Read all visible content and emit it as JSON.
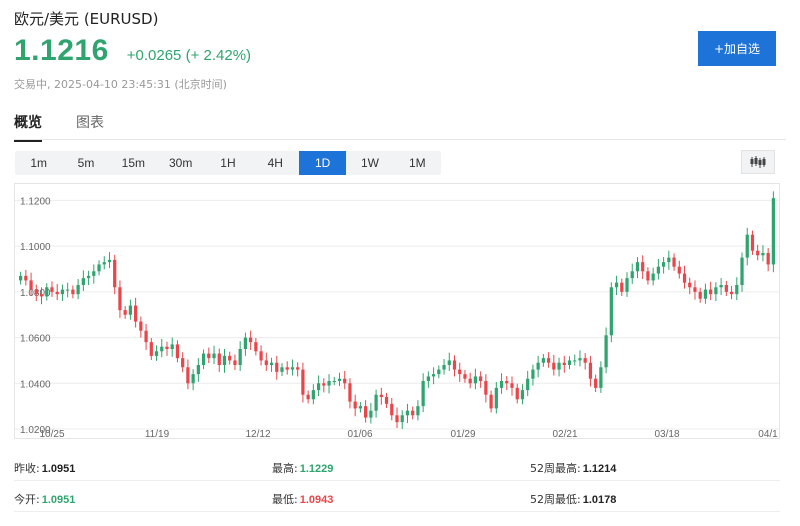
{
  "header": {
    "title": "欧元/美元  (EURUSD)",
    "price": "1.1216",
    "change": "+0.0265 (+ 2.42%)",
    "status": "交易中, 2025-04-10 23:45:31 (北京时间)",
    "add_button": "+加自选"
  },
  "tabs": [
    {
      "label": "概览",
      "active": true
    },
    {
      "label": "图表",
      "active": false
    }
  ],
  "periods": [
    "1m",
    "5m",
    "15m",
    "30m",
    "1H",
    "4H",
    "1D",
    "1W",
    "1M"
  ],
  "active_period": "1D",
  "colors": {
    "up": "#2fa46f",
    "down": "#e8464a",
    "accent": "#1e73d8"
  },
  "stats": {
    "prev_close": {
      "label": "昨收:",
      "value": "1.0951"
    },
    "open": {
      "label": "今开:",
      "value": "1.0951"
    },
    "high": {
      "label": "最高:",
      "value": "1.1229"
    },
    "low": {
      "label": "最低:",
      "value": "1.0943"
    },
    "week52_high": {
      "label": "52周最高:",
      "value": "1.1214"
    },
    "week52_low": {
      "label": "52周最低:",
      "value": "1.0178"
    }
  },
  "chart_data": {
    "type": "candlestick",
    "y_ticks": [
      "1.1200",
      "1.1000",
      "1.0800",
      "1.0600",
      "1.0400",
      "1.0200"
    ],
    "y_tick_values": [
      1.12,
      1.1,
      1.08,
      1.06,
      1.04,
      1.02
    ],
    "ylim": [
      1.02,
      1.125
    ],
    "x_ticks": [
      "10/25",
      "11/19",
      "12/12",
      "01/06",
      "01/29",
      "02/21",
      "03/18",
      "04/1"
    ],
    "grid": true,
    "closes": [
      1.087,
      1.085,
      1.081,
      1.079,
      1.078,
      1.082,
      1.08,
      1.079,
      1.081,
      1.081,
      1.079,
      1.083,
      1.086,
      1.087,
      1.089,
      1.092,
      1.093,
      1.094,
      1.082,
      1.072,
      1.07,
      1.074,
      1.067,
      1.063,
      1.058,
      1.052,
      1.054,
      1.056,
      1.055,
      1.057,
      1.051,
      1.047,
      1.04,
      1.044,
      1.048,
      1.053,
      1.051,
      1.053,
      1.048,
      1.052,
      1.05,
      1.048,
      1.055,
      1.06,
      1.058,
      1.054,
      1.05,
      1.048,
      1.049,
      1.045,
      1.047,
      1.046,
      1.047,
      1.046,
      1.035,
      1.033,
      1.037,
      1.04,
      1.039,
      1.041,
      1.041,
      1.042,
      1.04,
      1.032,
      1.029,
      1.03,
      1.025,
      1.028,
      1.035,
      1.034,
      1.031,
      1.026,
      1.023,
      1.026,
      1.028,
      1.026,
      1.03,
      1.041,
      1.043,
      1.044,
      1.046,
      1.048,
      1.05,
      1.046,
      1.044,
      1.042,
      1.04,
      1.043,
      1.041,
      1.035,
      1.029,
      1.038,
      1.041,
      1.04,
      1.038,
      1.033,
      1.037,
      1.042,
      1.046,
      1.049,
      1.051,
      1.049,
      1.046,
      1.049,
      1.048,
      1.05,
      1.05,
      1.051,
      1.049,
      1.042,
      1.038,
      1.047,
      1.061,
      1.082,
      1.084,
      1.08,
      1.086,
      1.089,
      1.093,
      1.089,
      1.085,
      1.088,
      1.091,
      1.093,
      1.095,
      1.091,
      1.088,
      1.084,
      1.082,
      1.08,
      1.077,
      1.081,
      1.079,
      1.082,
      1.083,
      1.08,
      1.079,
      1.083,
      1.095,
      1.105,
      1.098,
      1.096,
      1.097,
      1.092,
      1.121
    ]
  }
}
